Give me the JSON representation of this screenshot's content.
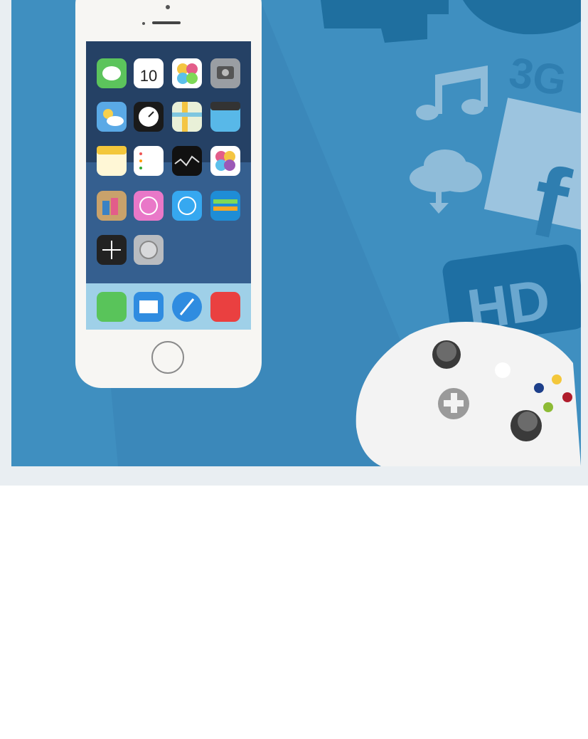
{
  "illustration": {
    "calendar_day": "10",
    "badge_3g": "3G",
    "badge_hd": "HD",
    "facebook_letter": "f"
  },
  "colors": {
    "background": "#3f8fc0",
    "frame": "#e9eef2",
    "dark_shapes": "#1f6f9f",
    "phone_body": "#f7f6f3"
  },
  "icons": [
    "messages-icon",
    "calendar-icon",
    "photos-icon",
    "camera-icon",
    "weather-icon",
    "clock-icon",
    "maps-icon",
    "videos-icon",
    "notes-icon",
    "reminders-icon",
    "stocks-icon",
    "game-center-icon",
    "newsstand-icon",
    "itunes-icon",
    "app-store-icon",
    "passbook-icon",
    "compass-icon",
    "settings-icon",
    "phone-icon",
    "mail-icon",
    "safari-icon",
    "music-icon"
  ]
}
